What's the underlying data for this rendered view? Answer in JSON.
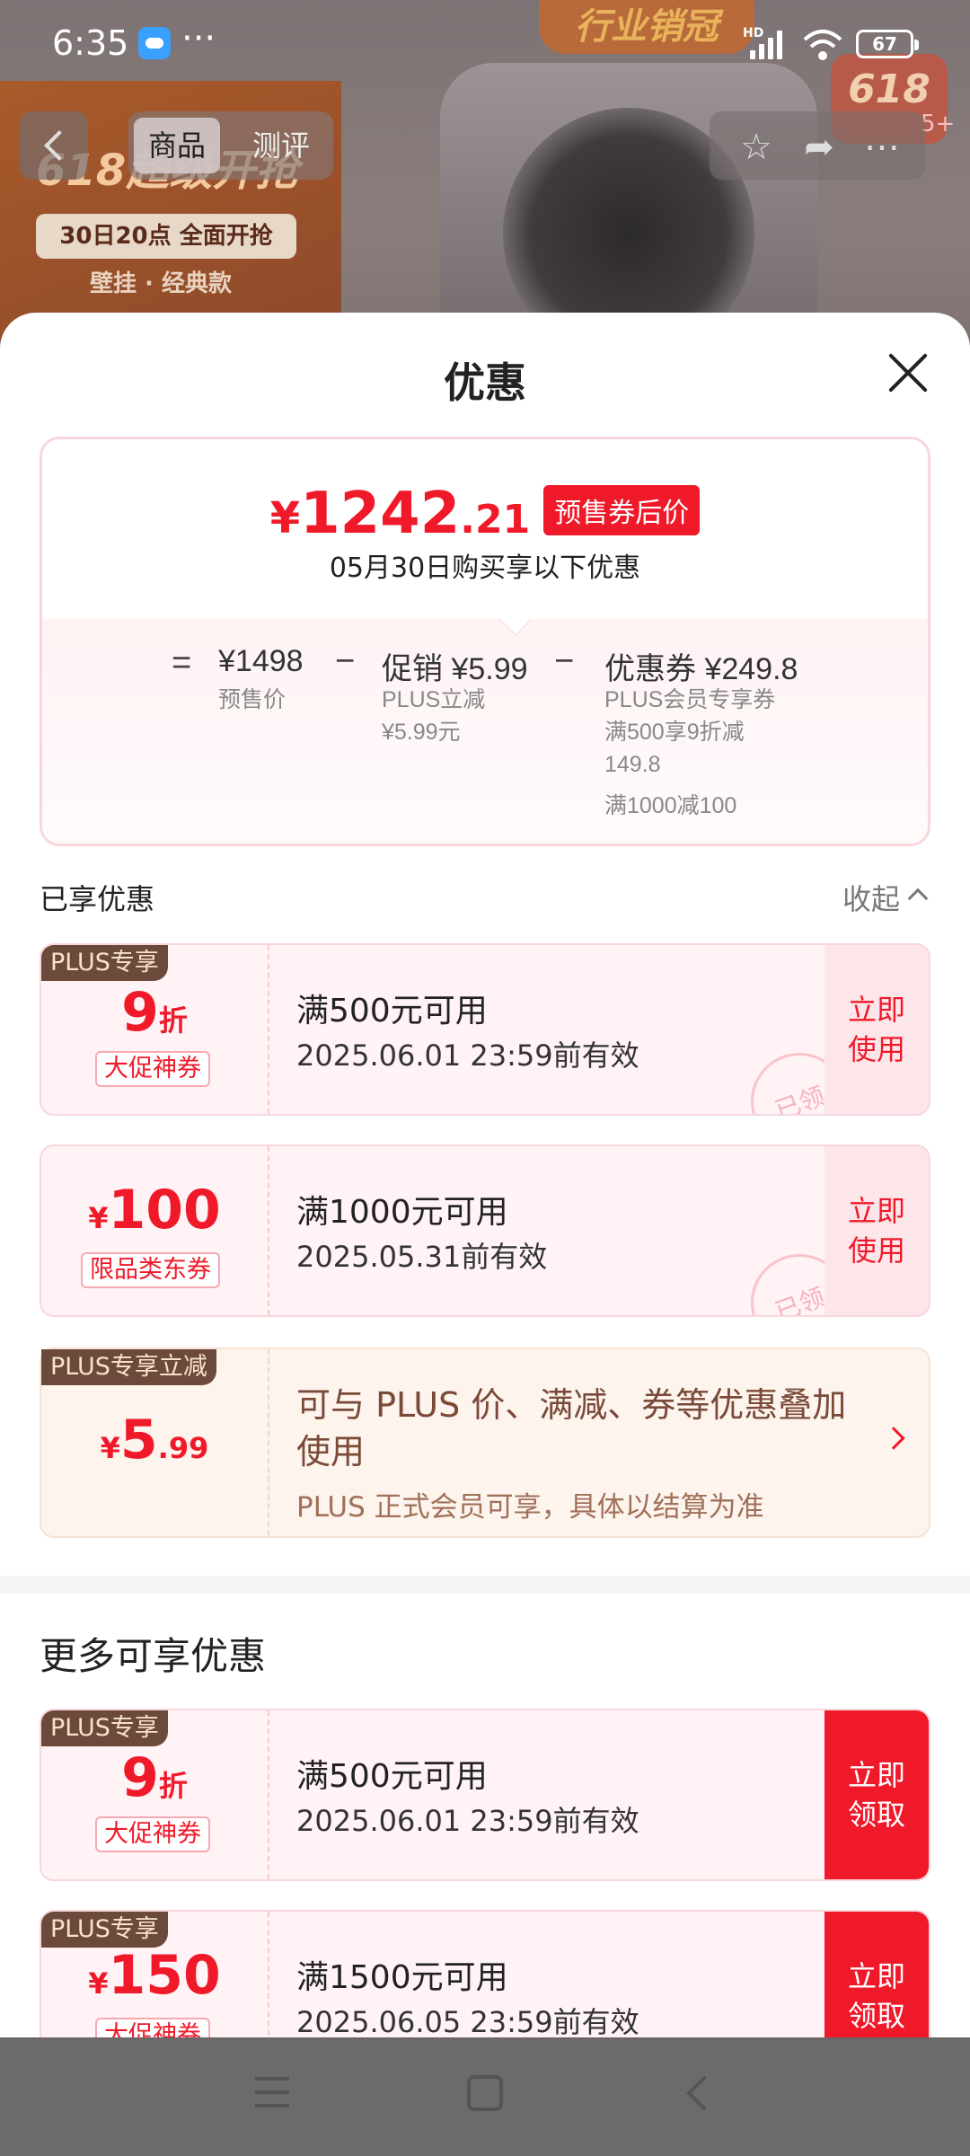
{
  "status_bar": {
    "time": "6:35",
    "dots": "···",
    "hd": "HD",
    "battery": "67"
  },
  "background": {
    "banner_line1": "618超级开抢",
    "banner_line2": "30日20点 全面开抢",
    "banner_line3": "壁挂 · 经典款",
    "top_badge": "行业销冠",
    "badge_618": "618",
    "cart_count": "5+",
    "nav_tabs": [
      "商品",
      "测评"
    ]
  },
  "sheet": {
    "title": "优惠",
    "price": {
      "yen": "¥",
      "int": "1242",
      "dec": ".21",
      "tag": "预售券后价",
      "subtitle": "05月30日购买享以下优惠"
    },
    "breakdown": {
      "eq": "=",
      "presale_value": "¥1498",
      "presale_label": "预售价",
      "minus1": "−",
      "promo_head": "促销 ¥5.99",
      "promo_sub1": "PLUS立减",
      "promo_sub2": "¥5.99元",
      "minus2": "−",
      "coupon_head": "优惠券 ¥249.8",
      "coupon_sub1": "PLUS会员专享券",
      "coupon_sub2": "满500享9折减",
      "coupon_sub3": "149.8",
      "coupon_sub4": "满1000减100"
    },
    "enjoyed_title": "已享优惠",
    "collapse_label": "收起",
    "enjoyed_coupons": [
      {
        "badge": "PLUS专享",
        "value_main": "9",
        "value_unit": "折",
        "kind": "大促神券",
        "condition": "满500元可用",
        "expiry": "2025.06.01 23:59前有效",
        "action": "立即使用",
        "stamp": "已领"
      },
      {
        "badge": "",
        "value_prefix": "¥",
        "value_main": "100",
        "kind": "限品类东券",
        "condition": "满1000元可用",
        "expiry": "2025.05.31前有效",
        "action": "立即使用",
        "stamp": "已领"
      }
    ],
    "plus_card": {
      "badge": "PLUS专享立减",
      "value_prefix": "¥",
      "value_main": "5",
      "value_dec": ".99",
      "text": "可与 PLUS 价、满减、券等优惠叠加使用",
      "subtext": "PLUS 正式会员可享，具体以结算为准"
    },
    "more_title": "更多可享优惠",
    "more_coupons": [
      {
        "badge": "PLUS专享",
        "value_main": "9",
        "value_unit": "折",
        "kind": "大促神券",
        "condition": "满500元可用",
        "expiry": "2025.06.01 23:59前有效",
        "action": "立即领取"
      },
      {
        "badge": "PLUS专享",
        "value_prefix": "¥",
        "value_main": "150",
        "kind": "大促神券",
        "condition": "满1500元可用",
        "expiry": "2025.06.05 23:59前有效",
        "action": "立即领取"
      }
    ]
  }
}
